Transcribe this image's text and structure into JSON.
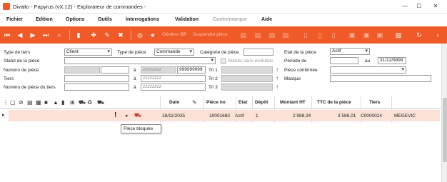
{
  "window": {
    "title": "Divalto - Papyrus (vX.12) - Explorateur de commandes -",
    "minimize": "—",
    "maximize": "☐",
    "close": "✕"
  },
  "menu": [
    "Fichier",
    "Edition",
    "Options",
    "Outils",
    "Interrogations",
    "Validation",
    "Contremarque",
    "Aide"
  ],
  "toolbar": {
    "generate_bp": "Générer BP",
    "delete_piece": "Suspendre pièce"
  },
  "filters": {
    "type_tiers_label": "Type de tiers",
    "type_tiers_value": "Client",
    "type_piece_label": "Type de pièce",
    "type_piece_value": "Commande",
    "categorie_label": "Catégorie de pièce",
    "categorie_value": "",
    "etat_label": "Etat de la pièce",
    "etat_value": "Actif",
    "statut_label": "Statut de la pièce",
    "statut_value": "",
    "statuts_sans_evolution": "Statuts sans évolution",
    "periode_label": "Période du",
    "periode_from": "",
    "periode_au": "au",
    "periode_to": "31/12/9999",
    "numero_label": "Numéro de pièce",
    "numero_from": "",
    "a1": "à",
    "numero_to_placeholder": "zzzzzzzz",
    "numero_to": "999999999",
    "tri1": "Tri 1",
    "piece_confirmee_label": "Pièce confirmée",
    "piece_confirmee_value": "",
    "tiers_label": "Tiers",
    "tiers_from": "",
    "a2": "à",
    "tiers_to": "zzzzzzzz",
    "tri2": "Tri 2",
    "masque_label": "Masque",
    "masque_value": "",
    "numero_tiers_label": "Numéro de pièce du tiers",
    "numero_tiers_from": "",
    "a3": "à",
    "numero_tiers_to": "zzzzzzzz",
    "tri3": "Tri 3",
    "sort_arrow": "↑"
  },
  "grid": {
    "columns": [
      "Date",
      "Pièce no",
      "Etat",
      "Dépôt",
      "Montant HT",
      "TTC de la pièce",
      "Tiers"
    ],
    "rows": [
      {
        "flag": "!",
        "date": "18/11/2025",
        "piece_no": "10001683",
        "etat": "Actif",
        "depot": "1",
        "montant_ht": "2 988,34",
        "ttc": "3 586,01",
        "tiers": "C0000024",
        "tiers_name": "MEGEVIC"
      }
    ],
    "tooltip": "Pièce bloquée"
  },
  "colors": {
    "accent": "#f05a28",
    "row_highlight": "#fbe1d6"
  }
}
